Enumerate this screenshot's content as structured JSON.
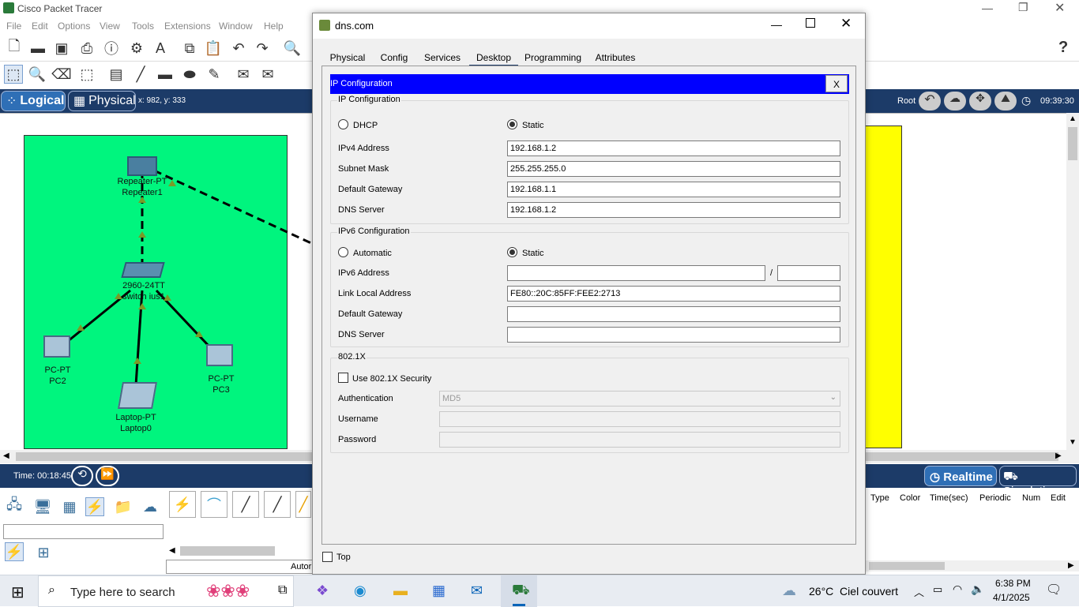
{
  "app": {
    "title": "Cisco Packet Tracer",
    "menu": [
      "File",
      "Edit",
      "Options",
      "View",
      "Tools",
      "Extensions",
      "Window",
      "Help"
    ],
    "help_icon": "?",
    "mode_logical": "Logical",
    "mode_physical": "Physical",
    "coords": "x: 982, y: 333",
    "root_label": "Root",
    "clock": "09:39:30",
    "time_label": "Time: 00:18:45",
    "realtime_label": "Realtime",
    "simulation_label": "Simulation",
    "event_cols": [
      "Type",
      "Color",
      "Time(sec)",
      "Periodic",
      "Num",
      "Edit"
    ],
    "auto_label": "Autor",
    "colors": {
      "modebar": "#1c3b68",
      "green_area": "#00f57e",
      "yellow_area": "#ffff00",
      "accent": "#0000ff"
    }
  },
  "topology": {
    "repeater": [
      "Repeater-PT",
      "Repeater1"
    ],
    "switch": [
      "2960-24TT",
      "switch ius1"
    ],
    "pc2": [
      "PC-PT",
      "PC2"
    ],
    "pc3": [
      "PC-PT",
      "PC3"
    ],
    "laptop": [
      "Laptop-PT",
      "Laptop0"
    ]
  },
  "dialog": {
    "title": "dns.com",
    "tabs": [
      "Physical",
      "Config",
      "Services",
      "Desktop",
      "Programming",
      "Attributes"
    ],
    "active_tab": "Desktop",
    "header": "IP Configuration",
    "close_x": "X",
    "ipv4": {
      "group": "IP Configuration",
      "dhcp": "DHCP",
      "static": "Static",
      "selected": "Static",
      "labels": {
        "ipv4": "IPv4 Address",
        "mask": "Subnet Mask",
        "gateway": "Default Gateway",
        "dns": "DNS Server"
      },
      "values": {
        "ipv4": "192.168.1.2",
        "mask": "255.255.255.0",
        "gateway": "192.168.1.1",
        "dns": "192.168.1.2"
      }
    },
    "ipv6": {
      "group": "IPv6 Configuration",
      "automatic": "Automatic",
      "static": "Static",
      "selected": "Static",
      "labels": {
        "addr": "IPv6 Address",
        "link": "Link Local Address",
        "gateway": "Default Gateway",
        "dns": "DNS Server"
      },
      "slash": "/",
      "values": {
        "addr": "",
        "prefix": "",
        "link": "FE80::20C:85FF:FEE2:2713",
        "gateway": "",
        "dns": ""
      }
    },
    "dot1x": {
      "group": "802.1X",
      "use": "Use 802.1X Security",
      "auth_label": "Authentication",
      "auth_value": "MD5",
      "user_label": "Username",
      "pass_label": "Password"
    },
    "top_label": "Top"
  },
  "taskbar": {
    "search_placeholder": "Type here to search",
    "weather": "26°C  Ciel couvert",
    "time": "6:38 PM",
    "date": "4/1/2025"
  }
}
